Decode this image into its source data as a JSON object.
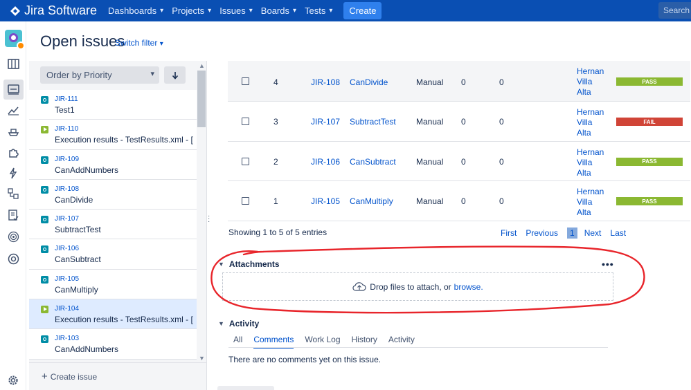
{
  "topbar": {
    "logo_text": "Jira Software",
    "nav": [
      {
        "label": "Dashboards"
      },
      {
        "label": "Projects"
      },
      {
        "label": "Issues"
      },
      {
        "label": "Boards"
      },
      {
        "label": "Tests"
      }
    ],
    "create_label": "Create",
    "search_placeholder": "Search"
  },
  "header": {
    "title": "Open issues",
    "switch_filter": "Switch filter"
  },
  "list": {
    "order_label": "Order by Priority",
    "issues": [
      {
        "key": "JIR-111",
        "summary": "Test1",
        "type": "test-icon"
      },
      {
        "key": "JIR-110",
        "summary": "Execution results - TestResults.xml - [...",
        "type": "execution-icon"
      },
      {
        "key": "JIR-109",
        "summary": "CanAddNumbers",
        "type": "test-icon"
      },
      {
        "key": "JIR-108",
        "summary": "CanDivide",
        "type": "test-icon"
      },
      {
        "key": "JIR-107",
        "summary": "SubtractTest",
        "type": "test-icon"
      },
      {
        "key": "JIR-106",
        "summary": "CanSubtract",
        "type": "test-icon"
      },
      {
        "key": "JIR-105",
        "summary": "CanMultiply",
        "type": "test-icon"
      },
      {
        "key": "JIR-104",
        "summary": "Execution results - TestResults.xml - [...",
        "type": "execution-icon",
        "selected": true
      },
      {
        "key": "JIR-103",
        "summary": "CanAddNumbers",
        "type": "test-icon"
      }
    ],
    "create_issue": "Create issue"
  },
  "tests_table": {
    "rows": [
      {
        "rank": "4",
        "key": "JIR-108",
        "summary": "CanDivide",
        "type": "Manual",
        "n1": "0",
        "n2": "0",
        "assignee": [
          "Hernan",
          "Villa",
          "Alta"
        ],
        "status": "PASS",
        "status_color": "#8bb832"
      },
      {
        "rank": "3",
        "key": "JIR-107",
        "summary": "SubtractTest",
        "type": "Manual",
        "n1": "0",
        "n2": "0",
        "assignee": [
          "Hernan",
          "Villa",
          "Alta"
        ],
        "status": "FAIL",
        "status_color": "#d04437"
      },
      {
        "rank": "2",
        "key": "JIR-106",
        "summary": "CanSubtract",
        "type": "Manual",
        "n1": "0",
        "n2": "0",
        "assignee": [
          "Hernan",
          "Villa",
          "Alta"
        ],
        "status": "PASS",
        "status_color": "#8bb832"
      },
      {
        "rank": "1",
        "key": "JIR-105",
        "summary": "CanMultiply",
        "type": "Manual",
        "n1": "0",
        "n2": "0",
        "assignee": [
          "Hernan",
          "Villa",
          "Alta"
        ],
        "status": "PASS",
        "status_color": "#8bb832"
      }
    ],
    "showing": "Showing 1 to 5 of 5 entries",
    "pager": {
      "first": "First",
      "previous": "Previous",
      "current": "1",
      "next": "Next",
      "last": "Last"
    }
  },
  "attachments": {
    "title": "Attachments",
    "more": "•••",
    "drop_text": "Drop files to attach, or",
    "browse": "browse."
  },
  "activity": {
    "title": "Activity",
    "tabs": [
      "All",
      "Comments",
      "Work Log",
      "History",
      "Activity"
    ],
    "active_tab": "Comments",
    "empty": "There are no comments yet on this issue."
  },
  "colors": {
    "topbar": "#0a4fb3",
    "link": "#0052cc",
    "pass": "#8bb832",
    "fail": "#d04437",
    "annotation": "#e8252b"
  }
}
